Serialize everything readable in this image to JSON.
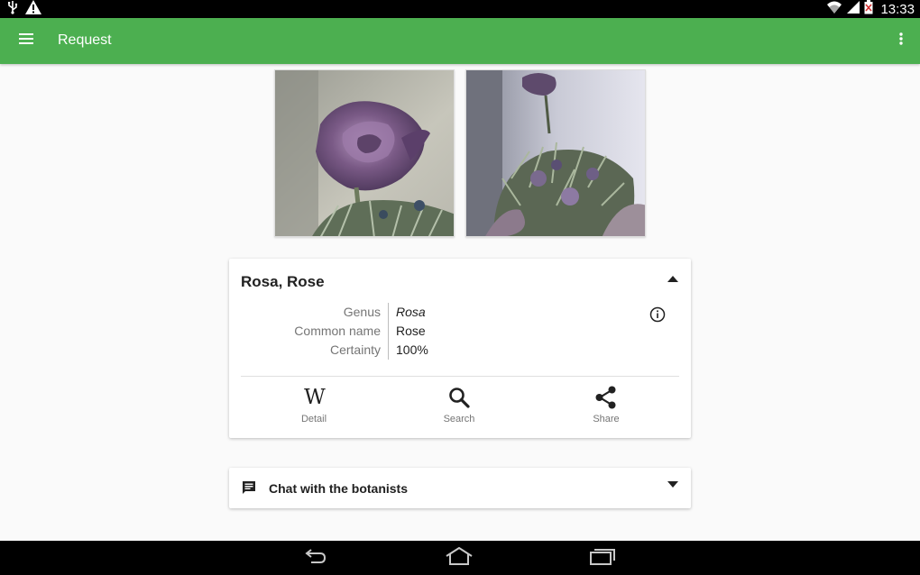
{
  "status_bar": {
    "time": "13:33",
    "icons": [
      "usb-icon",
      "warning-icon",
      "wifi-icon",
      "signal-icon",
      "battery-icon"
    ]
  },
  "app_bar": {
    "title": "Request",
    "icons": [
      "menu-icon",
      "overflow-menu-icon"
    ],
    "color": "#4caf50"
  },
  "photos": [
    {
      "name": "rose-photo-1"
    },
    {
      "name": "rose-photo-2"
    }
  ],
  "result": {
    "title": "Rosa, Rose",
    "details": [
      {
        "key": "Genus",
        "value": "Rosa",
        "italic": true
      },
      {
        "key": "Common name",
        "value": "Rose",
        "italic": false
      },
      {
        "key": "Certainty",
        "value": "100%",
        "italic": false
      }
    ],
    "actions": [
      {
        "label": "Detail",
        "icon": "wikipedia-icon"
      },
      {
        "label": "Search",
        "icon": "search-icon"
      },
      {
        "label": "Share",
        "icon": "share-icon"
      }
    ]
  },
  "chat": {
    "label": "Chat with the botanists",
    "icon": "message-icon"
  },
  "nav_bar": {
    "icons": [
      "back-icon",
      "home-icon",
      "recent-apps-icon"
    ]
  }
}
